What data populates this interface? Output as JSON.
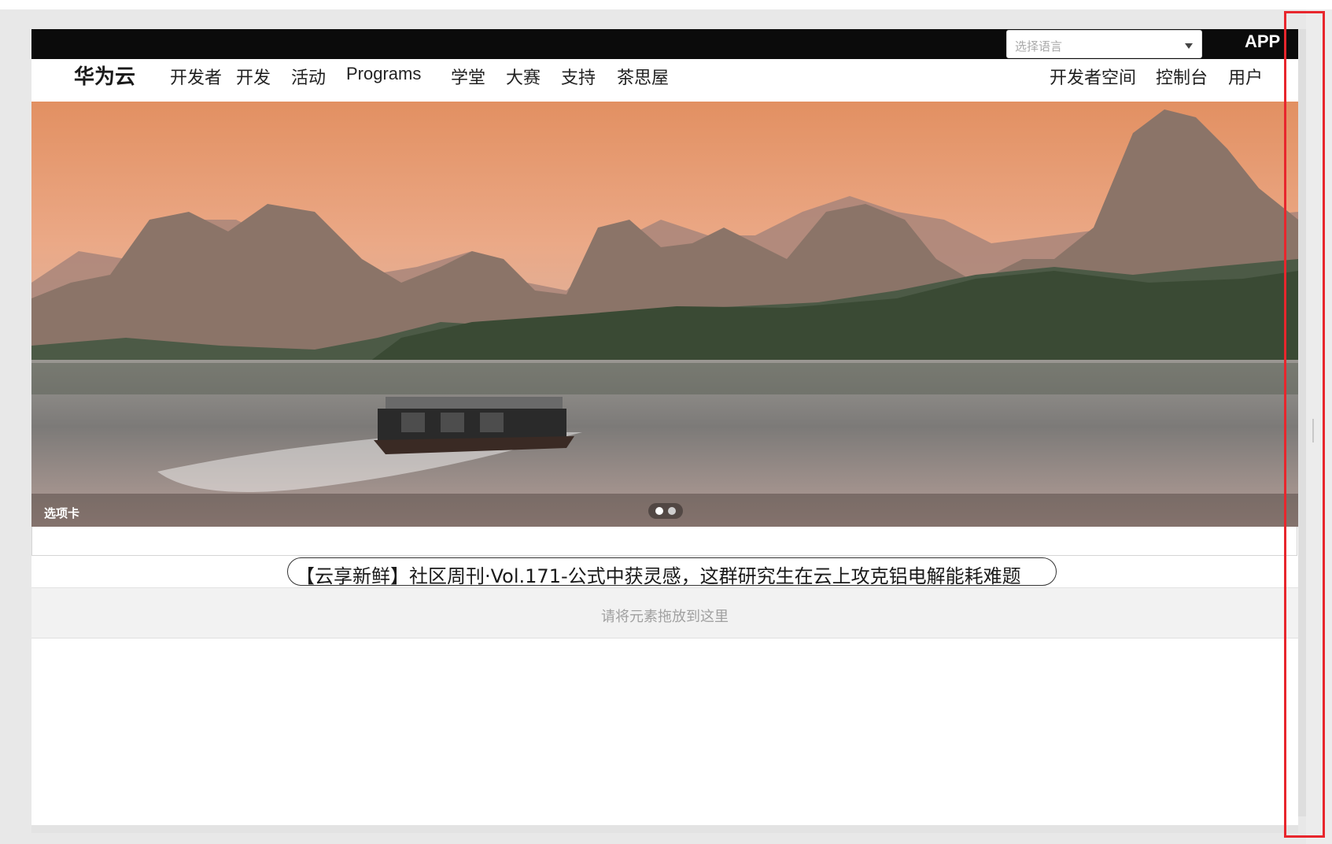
{
  "header": {
    "language_select": {
      "placeholder": "选择语言"
    },
    "app_label": "APP"
  },
  "nav": {
    "logo": "华为云",
    "left_items": [
      "开发者",
      "开发",
      "活动",
      "Programs",
      "学堂",
      "大赛",
      "支持",
      "茶思屋"
    ],
    "right_items": [
      "开发者空间",
      "控制台",
      "用户"
    ]
  },
  "banner": {
    "caption": "选项卡",
    "slide_count": 2,
    "active_slide": 1
  },
  "news": {
    "headline": "【云享新鲜】社区周刊·Vol.171-公式中获灵感，这群研究生在云上攻克铝电解能耗难题"
  },
  "drop_zone": {
    "text": "请将元素拖放到这里"
  },
  "colors": {
    "top_bar": "#0b0b0b",
    "highlight": "#e8262d",
    "page_bg": "#e8e8e8"
  }
}
